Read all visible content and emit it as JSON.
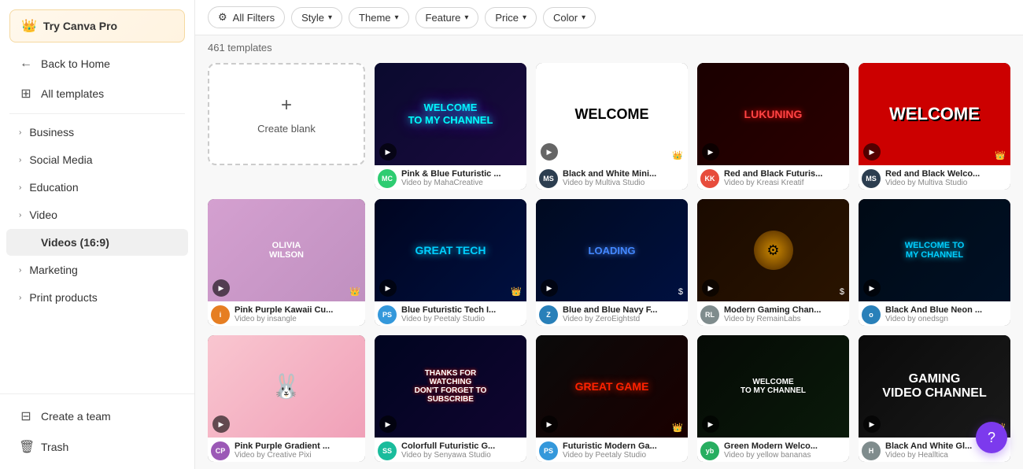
{
  "sidebar": {
    "try_pro_label": "Try Canva Pro",
    "items": [
      {
        "id": "back-home",
        "label": "Back to Home",
        "icon": "←",
        "type": "nav"
      },
      {
        "id": "all-templates",
        "label": "All templates",
        "icon": "⊞",
        "type": "nav"
      },
      {
        "id": "business",
        "label": "Business",
        "icon": "›",
        "type": "expand"
      },
      {
        "id": "social-media",
        "label": "Social Media",
        "icon": "›",
        "type": "expand"
      },
      {
        "id": "education",
        "label": "Education",
        "icon": "›",
        "type": "expand"
      },
      {
        "id": "video",
        "label": "Video",
        "icon": "›",
        "type": "expand"
      },
      {
        "id": "videos-16-9",
        "label": "Videos (16:9)",
        "icon": "",
        "type": "active"
      },
      {
        "id": "marketing",
        "label": "Marketing",
        "icon": "›",
        "type": "expand"
      },
      {
        "id": "print-products",
        "label": "Print products",
        "icon": "›",
        "type": "expand"
      }
    ],
    "bottom_items": [
      {
        "id": "create-team",
        "label": "Create a team",
        "icon": "⊟"
      },
      {
        "id": "trash",
        "label": "Trash",
        "icon": "🗑"
      }
    ]
  },
  "filters": {
    "all_filters_label": "All Filters",
    "style_label": "Style",
    "theme_label": "Theme",
    "feature_label": "Feature",
    "price_label": "Price",
    "color_label": "Color"
  },
  "templates_count": "461 templates",
  "create_blank_label": "Create blank",
  "templates": [
    {
      "id": 1,
      "title": "Pink & Blue Futuristic ...",
      "author": "Video by MahaCreative",
      "bg": "pink-blue",
      "content_type": "welcome-neon",
      "has_play": true,
      "badge": null,
      "avatar_color": "#2ecc71",
      "avatar_text": "MC"
    },
    {
      "id": 2,
      "title": "Black and White Mini...",
      "author": "Video by Multiva Studio",
      "bg": "bw",
      "content_type": "welcome-white",
      "has_play": true,
      "badge": "crown",
      "avatar_color": "#2c3e50",
      "avatar_text": "MS"
    },
    {
      "id": 3,
      "title": "Red and Black Futuris...",
      "author": "Video by Kreasi Kreatif",
      "bg": "red-black",
      "content_type": "lukuning",
      "has_play": true,
      "badge": null,
      "avatar_color": "#e74c3c",
      "avatar_text": "KK"
    },
    {
      "id": 4,
      "title": "Red and Black Welco...",
      "author": "Video by Multiva Studio",
      "bg": "red-welcome",
      "content_type": "welcome-red",
      "has_play": true,
      "badge": "crown",
      "avatar_color": "#2c3e50",
      "avatar_text": "MS"
    },
    {
      "id": 5,
      "title": "Pink Purple Kawaii Cu...",
      "author": "Video by insangle",
      "bg": "pink-kawaii",
      "content_type": "olivia-wilson",
      "has_play": true,
      "badge": "crown",
      "avatar_color": "#e67e22",
      "avatar_text": "i"
    },
    {
      "id": 6,
      "title": "Blue Futuristic Tech I...",
      "author": "Video by Peetaly Studio",
      "bg": "blue-tech",
      "content_type": "great-tech",
      "has_play": true,
      "badge": "crown",
      "avatar_color": "#3498db",
      "avatar_text": "PS"
    },
    {
      "id": 7,
      "title": "Blue and Blue Navy F...",
      "author": "Video by ZeroEightstd",
      "bg": "blue-navy",
      "content_type": "loading",
      "has_play": true,
      "badge": "dollar",
      "avatar_color": "#2980b9",
      "avatar_text": "Z"
    },
    {
      "id": 8,
      "title": "Modern Gaming Chan...",
      "author": "Video by RemainLabs",
      "bg": "gaming",
      "content_type": "gaming-gear",
      "has_play": true,
      "badge": "dollar",
      "avatar_color": "#7f8c8d",
      "avatar_text": "RL"
    },
    {
      "id": 9,
      "title": "Black And Blue Neon ...",
      "author": "Video by onedsgn",
      "bg": "blue-neon",
      "content_type": "my-channel",
      "has_play": true,
      "badge": null,
      "avatar_color": "#2980b9",
      "avatar_text": "o"
    },
    {
      "id": 10,
      "title": "Pink Purple Gradient ...",
      "author": "Video by Creative Pixi",
      "bg": "pink-gradient",
      "content_type": "pink-bunny",
      "has_play": true,
      "badge": null,
      "avatar_color": "#9b59b6",
      "avatar_text": "CP"
    },
    {
      "id": 11,
      "title": "Colorfull Futuristic G...",
      "author": "Video by Senyawa Studio",
      "bg": "colorful",
      "content_type": "watching",
      "has_play": true,
      "badge": null,
      "avatar_color": "#1abc9c",
      "avatar_text": "SS"
    },
    {
      "id": 12,
      "title": "Futuristic Modern Ga...",
      "author": "Video by Peetaly Studio",
      "bg": "futuristic-ga",
      "content_type": "great-game",
      "has_play": true,
      "badge": "crown",
      "avatar_color": "#3498db",
      "avatar_text": "PS"
    },
    {
      "id": 13,
      "title": "Green Modern Welco...",
      "author": "Video by yellow bananas",
      "bg": "green-modern",
      "content_type": "welcome-channel",
      "has_play": true,
      "badge": null,
      "avatar_color": "#27ae60",
      "avatar_text": "yb"
    },
    {
      "id": 14,
      "title": "Black And White Gl...",
      "author": "Video by Healltica",
      "bg": "bw-gl",
      "content_type": "gaming-channel",
      "has_play": true,
      "badge": "crown",
      "avatar_color": "#7f8c8d",
      "avatar_text": "H"
    }
  ],
  "fab": {
    "icon": "?",
    "label": "Help"
  }
}
